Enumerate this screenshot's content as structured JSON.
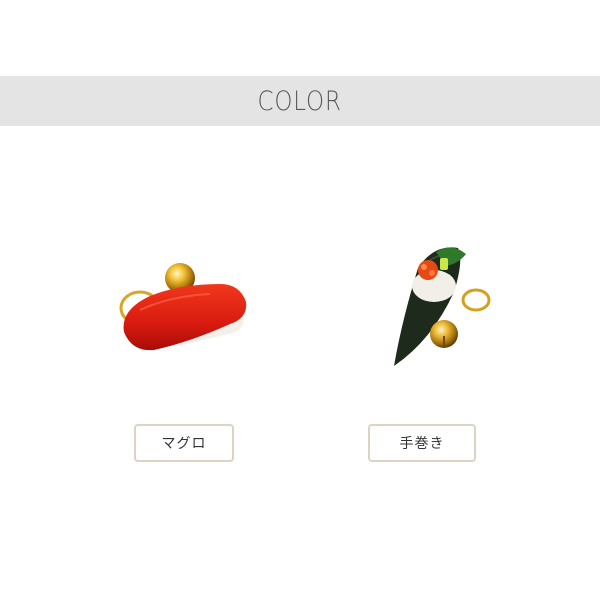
{
  "header": {
    "title": "COLOR"
  },
  "colors": {
    "header_band": "#e4e4e4",
    "button_border": "#ddd3c3"
  },
  "variants": [
    {
      "label": "マグロ",
      "image": "tuna-nigiri-keychain"
    },
    {
      "label": "手巻き",
      "image": "hand-roll-keychain"
    }
  ]
}
